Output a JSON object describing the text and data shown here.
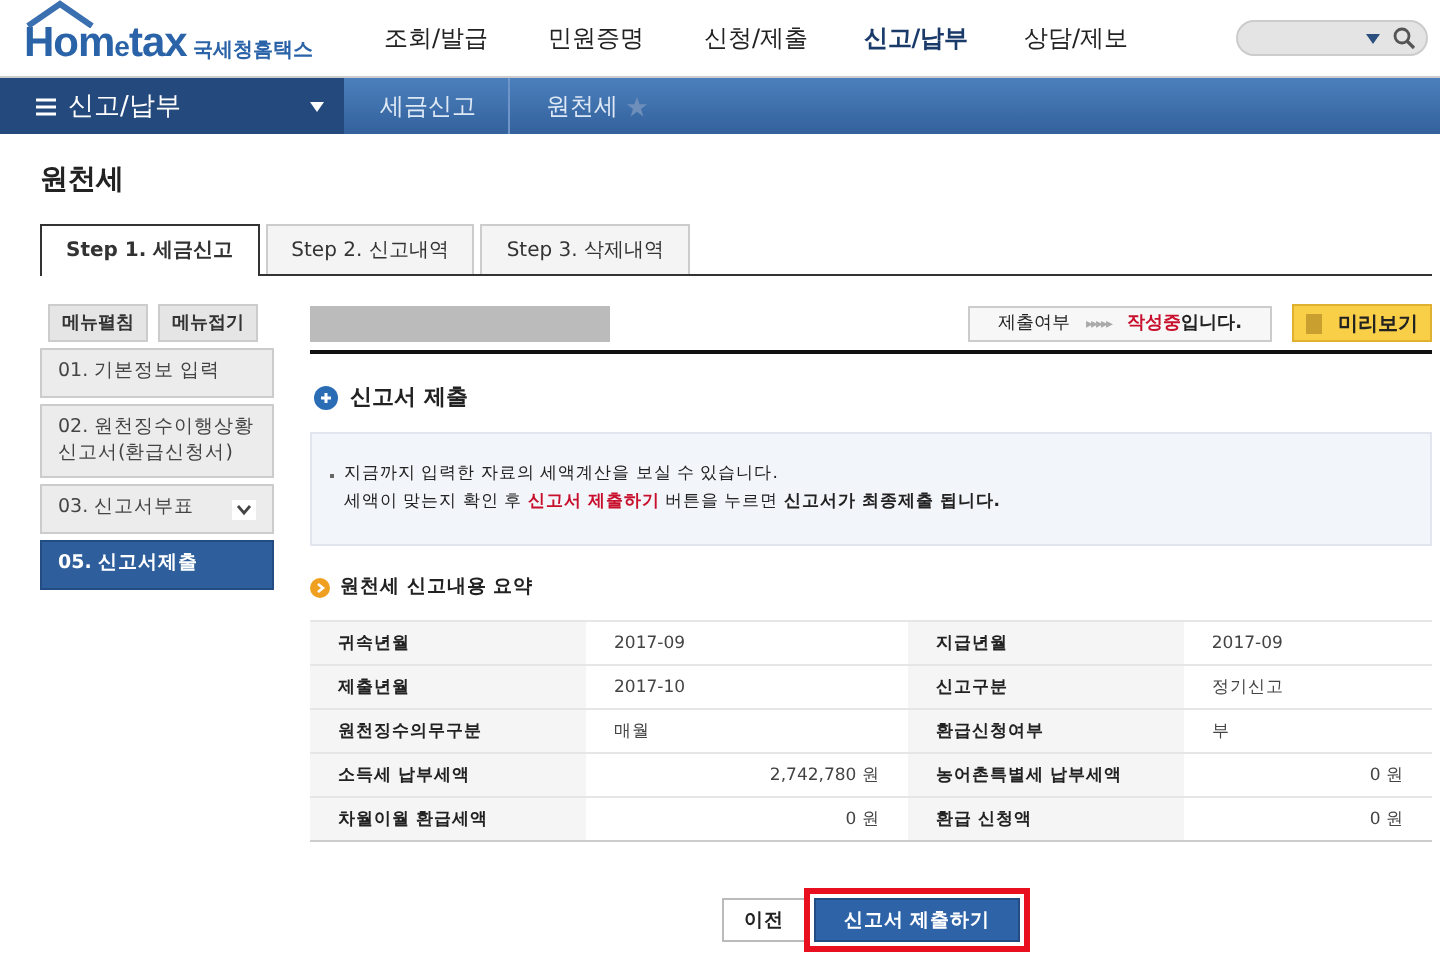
{
  "header": {
    "logo": {
      "brand_a": "Hom",
      "brand_e": "e",
      "brand_b": "tax",
      "name": "국세청홈택스"
    },
    "nav": [
      {
        "label": "조회/발급",
        "selected": false
      },
      {
        "label": "민원증명",
        "selected": false
      },
      {
        "label": "신청/제출",
        "selected": false
      },
      {
        "label": "신고/납부",
        "selected": true
      },
      {
        "label": "상담/제보",
        "selected": false
      }
    ]
  },
  "menu_bar": {
    "menu": "신고/납부",
    "breadcrumbs": [
      "세금신고",
      "원천세"
    ]
  },
  "page_title": "원천세",
  "tabs": [
    {
      "label": "Step 1. 세금신고",
      "selected": true
    },
    {
      "label": "Step 2. 신고내역",
      "selected": false
    },
    {
      "label": "Step 3. 삭제내역",
      "selected": false
    }
  ],
  "side": {
    "buttons": [
      "메뉴펼침",
      "메뉴접기"
    ],
    "items": [
      {
        "label": "01. 기본정보 입력",
        "selected": false,
        "kind": "plain"
      },
      {
        "label": "02. 원천징수이행상황신고서(환급신청서)",
        "selected": false,
        "kind": "plain"
      },
      {
        "label": "03. 신고서부표",
        "selected": false,
        "kind": "dropdown"
      },
      {
        "label": "05. 신고서제출",
        "selected": true,
        "kind": "plain"
      }
    ]
  },
  "status": {
    "label": "제출여부",
    "arrows": "▸▸▸▸▸",
    "state": "작성중",
    "suffix": "입니다.",
    "preview": "미리보기"
  },
  "section_title": "신고서 제출",
  "notice": [
    "지금까지 입력한 자료의 세액계산을 보실 수 있습니다.",
    "세액이 맞는지 확인 후 **신고서 제출하기** 버튼을 누르면 **신고서가 최종제출 됩니다.**"
  ],
  "summary_title": "원천세 신고내용 요약",
  "table": {
    "rows": [
      [
        "귀속년월",
        "2017-09",
        "지급년월",
        "2017-09"
      ],
      [
        "제출년월",
        "2017-10",
        "신고구분",
        "정기신고"
      ],
      [
        "원천징수의무구분",
        "매월",
        "환급신청여부",
        "부"
      ],
      [
        "소득세 납부세액",
        "2,742,780 원",
        "농어촌특별세 납부세액",
        "0 원"
      ],
      [
        "차월이월 환급세액",
        "0 원",
        "환급 신청액",
        "0 원"
      ]
    ],
    "right_aligned_rows": [
      false,
      false,
      false,
      true,
      true
    ]
  },
  "buttons": [
    {
      "label": "이전",
      "kind": "secondary",
      "highlighted": false
    },
    {
      "label": "신고서 제출하기",
      "kind": "primary",
      "highlighted": true
    }
  ]
}
